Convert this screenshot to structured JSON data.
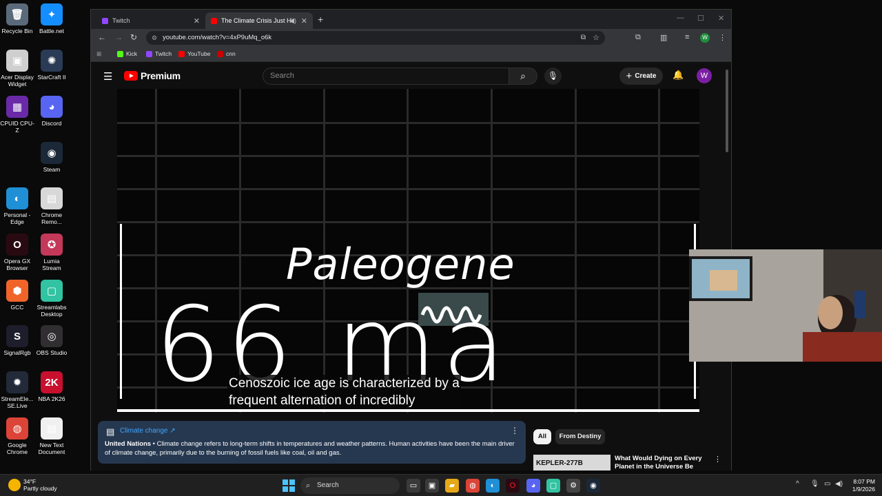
{
  "desktop": {
    "icons": [
      {
        "label": "Recycle Bin",
        "glyph": "🗑",
        "color": "#5a6a7a"
      },
      {
        "label": "Battle.net",
        "glyph": "✦",
        "color": "#148eff"
      },
      {
        "label": "Acer Display Widget",
        "glyph": "▣",
        "color": "#cfcfcf"
      },
      {
        "label": "StarCraft II",
        "glyph": "✺",
        "color": "#2a3b55"
      },
      {
        "label": "CPUID CPU-Z",
        "glyph": "▦",
        "color": "#6a2aa8"
      },
      {
        "label": "Discord",
        "glyph": "◕",
        "color": "#5865f2"
      },
      {
        "label": "Steam",
        "glyph": "◉",
        "color": "#1b2838"
      },
      {
        "label": "Personal - Edge",
        "glyph": "◐",
        "color": "#1f8fd6"
      },
      {
        "label": "Chrome Remo...",
        "glyph": "▤",
        "color": "#d8d8d8"
      },
      {
        "label": "Opera GX Browser",
        "glyph": "O",
        "color": "#2a0a12"
      },
      {
        "label": "Lumia Stream",
        "glyph": "✪",
        "color": "#c4385a"
      },
      {
        "label": "GCC",
        "glyph": "⬢",
        "color": "#f0642a"
      },
      {
        "label": "Streamlabs Desktop",
        "glyph": "▢",
        "color": "#31c3a2"
      },
      {
        "label": "SignalRgb",
        "glyph": "S",
        "color": "#1d1d2b"
      },
      {
        "label": "OBS Studio",
        "glyph": "◎",
        "color": "#302e31"
      },
      {
        "label": "StreamEle... SE.Live",
        "glyph": "✹",
        "color": "#222a3a"
      },
      {
        "label": "NBA 2K26",
        "glyph": "2K",
        "color": "#c8102e"
      },
      {
        "label": "Google Chrome",
        "glyph": "◍",
        "color": "#db4437"
      },
      {
        "label": "New Text Document",
        "glyph": "▤",
        "color": "#f0f0f0"
      }
    ]
  },
  "browser": {
    "tabs": [
      {
        "title": "Twitch",
        "color": "#9146ff"
      },
      {
        "title": "The Climate Crisis Just Hit",
        "color": "#ff0000"
      }
    ],
    "new_tab": "+",
    "url": "youtube.com/watch?v=4xP9uMq_o6k",
    "bookmarks": [
      {
        "label": "Kick",
        "color": "#53fc18"
      },
      {
        "label": "Twitch",
        "color": "#9146ff"
      },
      {
        "label": "YouTube",
        "color": "#ff0000"
      },
      {
        "label": "cnn",
        "color": "#cc0000"
      }
    ],
    "profile_initial": "W",
    "accent": "#1e8e3e"
  },
  "youtube": {
    "logo_text": "Premium",
    "search_placeholder": "Search",
    "create_label": "Create",
    "avatar_initial": "W",
    "video": {
      "title_text": "Paleogene",
      "big_text": "66 ma",
      "subtitle_line1": "Cenoszoic ice age is characterized by a",
      "subtitle_line2": "frequent alternation of incredibly"
    },
    "info_card": {
      "title": "Climate change ↗",
      "source": "United Nations",
      "body": " • Climate change refers to long-term shifts in temperatures and weather patterns. Human activities have been the main driver of climate change, primarily due to the burning of fossil fuels like coal, oil and gas."
    },
    "chips": [
      "All",
      "From Destiny"
    ],
    "recommended": {
      "thumb_text": "KEPLER-277B",
      "title": "What Would Dying on Every Planet in the Universe Be Like?"
    }
  },
  "taskbar": {
    "temp": "34°F",
    "weather": "Partly cloudy",
    "search_label": "Search",
    "time": "8:07 PM",
    "date": "1/9/2026"
  }
}
